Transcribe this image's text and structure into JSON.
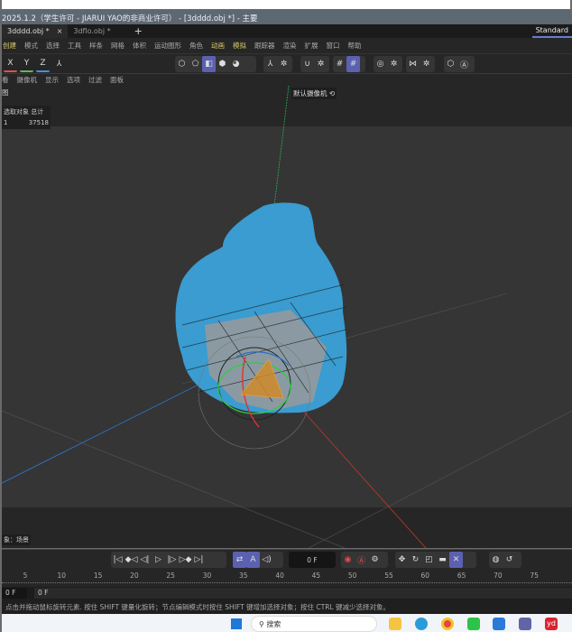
{
  "window": {
    "title": "2025.1.2（学生许可 - JIARUI YAO的非商业许可） - [3dddd.obj *] - 主要"
  },
  "tabs": [
    {
      "label": "3dddd.obj *",
      "active": true,
      "close": "×"
    },
    {
      "label": "3dflo.obj *",
      "active": false
    }
  ],
  "new_tab": "+",
  "layout_label": "Standard",
  "menu": [
    "创建",
    "模式",
    "选择",
    "工具",
    "样条",
    "网格",
    "体积",
    "运动图形",
    "角色",
    "动画",
    "模拟",
    "跟踪器",
    "渲染",
    "扩展",
    "窗口",
    "帮助"
  ],
  "axis_toggles": [
    {
      "label": "X",
      "color": "#d9534f"
    },
    {
      "label": "Y",
      "color": "#5cb85c"
    },
    {
      "label": "Z",
      "color": "#4a90d9"
    }
  ],
  "viewport_menu": [
    "看",
    "摄像机",
    "显示",
    "选项",
    "过滤",
    "面板"
  ],
  "viewport": {
    "title": "图",
    "camera": "默认摄像机",
    "stats": {
      "headers": [
        "选取对象",
        "总计"
      ],
      "values": [
        "1",
        "37518"
      ]
    },
    "scene_label": "象：场景"
  },
  "colors": {
    "accent": "#5b61b0",
    "mesh": "#3a9cd0",
    "x_axis": "#c0392b",
    "y_axis": "#27ae60",
    "z_axis": "#2e6fc0"
  },
  "timeline": {
    "current_frame": "0 F",
    "start_frame": "0 F",
    "end_frame": "0 F",
    "ruler": [
      "5",
      "10",
      "15",
      "20",
      "25",
      "30",
      "35",
      "40",
      "45",
      "50",
      "55",
      "60",
      "65",
      "70",
      "75"
    ]
  },
  "status": "点击并拖动鼠标旋转元素. 按住 SHIFT 键量化旋转；节点编辑模式时按住 SHIFT 键增加选择对象；按住 CTRL 键减少选择对象。",
  "taskbar": {
    "search_placeholder": "搜索"
  }
}
